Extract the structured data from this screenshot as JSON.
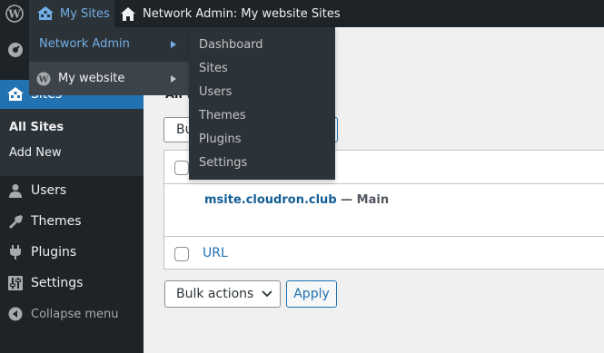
{
  "adminbar": {
    "wp_icon": "wordpress-logo-icon",
    "my_sites_label": "My Sites",
    "my_sites_icon": "multisite-icon",
    "network_label": "Network Admin: My website Sites",
    "network_icon": "home-icon"
  },
  "dropdown": {
    "network_admin": "Network Admin",
    "my_website": "My website",
    "network_submenu": [
      "Dashboard",
      "Sites",
      "Users",
      "Themes",
      "Plugins",
      "Settings"
    ]
  },
  "sidebar": {
    "sites_label": "Sites",
    "sites_submenu": [
      "All Sites",
      "Add New"
    ],
    "items": [
      {
        "label": "Users",
        "icon": "users-icon"
      },
      {
        "label": "Themes",
        "icon": "themes-icon"
      },
      {
        "label": "Plugins",
        "icon": "plugins-icon"
      },
      {
        "label": "Settings",
        "icon": "settings-icon"
      }
    ],
    "collapse_label": "Collapse menu"
  },
  "content": {
    "heading_fragment": "All (",
    "bulk_top_label": "Bul",
    "site_name": "msite.cloudron.club",
    "site_separator": " — Main",
    "url_column": "URL",
    "bulk_actions_label": "Bulk actions",
    "apply_label": "Apply"
  },
  "colors": {
    "admin_bar_bg": "#1d2327",
    "submenu_bg": "#2c3338",
    "accent": "#2271b1",
    "link": "#72aee6"
  }
}
